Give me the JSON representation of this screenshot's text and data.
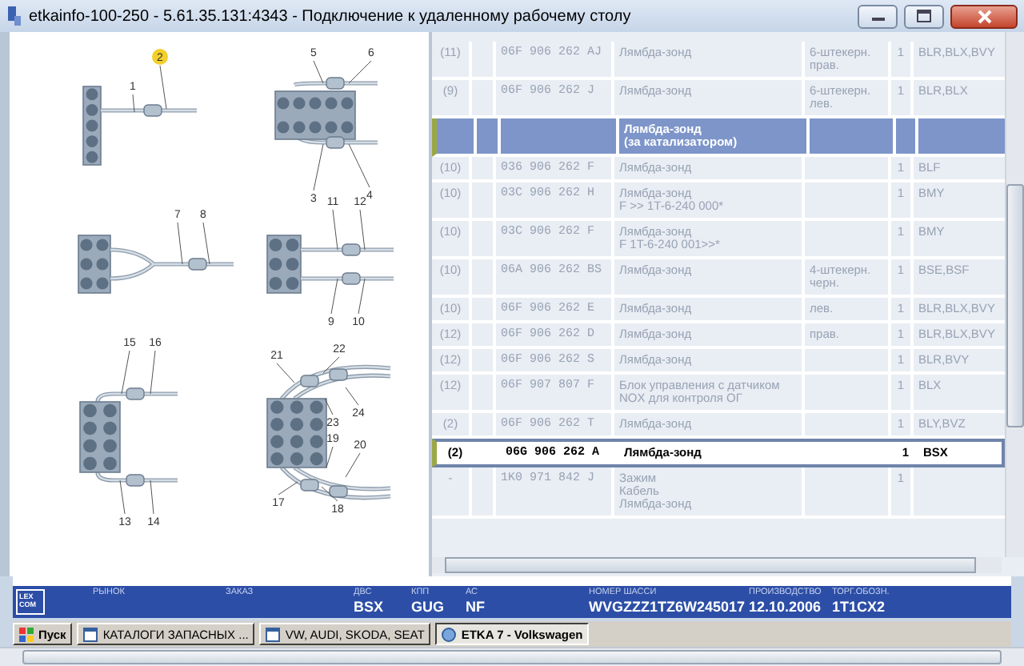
{
  "window": {
    "title": "etkainfo-100-250 - 5.61.35.131:4343 - Подключение к удаленному рабочему столу"
  },
  "diagram": {
    "callouts": [
      {
        "label": "2",
        "selected": true
      },
      {
        "label": "1",
        "selected": false
      },
      {
        "label": "5",
        "selected": false
      },
      {
        "label": "6",
        "selected": false
      },
      {
        "label": "3",
        "selected": false
      },
      {
        "label": "4",
        "selected": false
      },
      {
        "label": "7",
        "selected": false
      },
      {
        "label": "8",
        "selected": false
      },
      {
        "label": "11",
        "selected": false
      },
      {
        "label": "12",
        "selected": false
      },
      {
        "label": "9",
        "selected": false
      },
      {
        "label": "10",
        "selected": false
      },
      {
        "label": "15",
        "selected": false
      },
      {
        "label": "16",
        "selected": false
      },
      {
        "label": "13",
        "selected": false
      },
      {
        "label": "14",
        "selected": false
      },
      {
        "label": "21",
        "selected": false
      },
      {
        "label": "22",
        "selected": false
      },
      {
        "label": "23",
        "selected": false
      },
      {
        "label": "24",
        "selected": false
      },
      {
        "label": "19",
        "selected": false
      },
      {
        "label": "20",
        "selected": false
      },
      {
        "label": "17",
        "selected": false
      },
      {
        "label": "18",
        "selected": false
      }
    ]
  },
  "table": {
    "rows": [
      {
        "kind": "part",
        "selected": false,
        "position": "(11)",
        "part_number": "06F 906 262 AJ",
        "name": "Лямбда-зонд",
        "note": "6-штекерн.\nправ.",
        "quantity": "1",
        "models": "BLR,BLX,BVY"
      },
      {
        "kind": "part",
        "selected": false,
        "position": "(9)",
        "part_number": "06F 906 262 J",
        "name": "Лямбда-зонд",
        "note": "6-штекерн.\nлев.",
        "quantity": "1",
        "models": "BLR,BLX"
      },
      {
        "kind": "group",
        "selected": false,
        "name": "Лямбда-зонд\n(за катализатором)"
      },
      {
        "kind": "part",
        "selected": false,
        "position": "(10)",
        "part_number": "036 906 262 F",
        "name": "Лямбда-зонд",
        "quantity": "1",
        "models": "BLF"
      },
      {
        "kind": "part",
        "selected": false,
        "position": "(10)",
        "part_number": "03C 906 262 H",
        "name": "Лямбда-зонд\nF >> 1T-6-240 000*",
        "quantity": "1",
        "models": "BMY"
      },
      {
        "kind": "part",
        "selected": false,
        "position": "(10)",
        "part_number": "03C 906 262 F",
        "name": "Лямбда-зонд\nF 1T-6-240 001>>*",
        "quantity": "1",
        "models": "BMY"
      },
      {
        "kind": "part",
        "selected": false,
        "position": "(10)",
        "part_number": "06A 906 262 BS",
        "name": "Лямбда-зонд",
        "note": "4-штекерн.\nчерн.",
        "quantity": "1",
        "models": "BSE,BSF"
      },
      {
        "kind": "part",
        "selected": false,
        "position": "(10)",
        "part_number": "06F 906 262 E",
        "name": "Лямбда-зонд",
        "note": "лев.",
        "quantity": "1",
        "models": "BLR,BLX,BVY"
      },
      {
        "kind": "part",
        "selected": false,
        "position": "(12)",
        "part_number": "06F 906 262 D",
        "name": "Лямбда-зонд",
        "note": "прав.",
        "quantity": "1",
        "models": "BLR,BLX,BVY"
      },
      {
        "kind": "part",
        "selected": false,
        "position": "(12)",
        "part_number": "06F 906 262 S",
        "name": "Лямбда-зонд",
        "quantity": "1",
        "models": "BLR,BVY"
      },
      {
        "kind": "part",
        "selected": false,
        "position": "(12)",
        "part_number": "06F 907 807 F",
        "name": "Блок управления с датчиком NOX для контроля ОГ",
        "quantity": "1",
        "models": "BLX"
      },
      {
        "kind": "part",
        "selected": false,
        "position": "(2)",
        "part_number": "06F 906 262 T",
        "name": "Лямбда-зонд",
        "quantity": "1",
        "models": "BLY,BVZ"
      },
      {
        "kind": "part",
        "selected": true,
        "position": "(2)",
        "part_number": "06G 906 262 A",
        "name": "Лямбда-зонд",
        "quantity": "1",
        "models": "BSX"
      },
      {
        "kind": "part",
        "selected": false,
        "position": "-",
        "part_number": "1K0 971 842 J",
        "name": "Зажим\nКабель\nЛямбда-зонд",
        "quantity": "1"
      }
    ]
  },
  "info_bar": {
    "logo": "LEX\nCOM",
    "fields": [
      {
        "label": "РЫНОК"
      },
      {
        "label": "ЗАКАЗ"
      },
      {
        "label": "ДВС",
        "value": "BSX"
      },
      {
        "label": "КПП",
        "value": "GUG"
      },
      {
        "label": "АС",
        "value": "NF"
      },
      {
        "label": "НОМЕР ШАССИ",
        "value": "WVGZZZ1TZ6W245017"
      },
      {
        "label": "ПРОИЗВОДСТВО",
        "value": "12.10.2006"
      },
      {
        "label": "ТОРГ.ОБОЗН.",
        "value": "1T1CX2"
      }
    ]
  },
  "taskbar": {
    "start": "Пуск",
    "tasks": [
      {
        "label": "КАТАЛОГИ ЗАПАСНЫХ ...",
        "selected": false
      },
      {
        "label": "VW, AUDI, SKODA, SEAT",
        "selected": false
      },
      {
        "label": "ETKA 7 - Volkswagen",
        "selected": true
      }
    ]
  }
}
